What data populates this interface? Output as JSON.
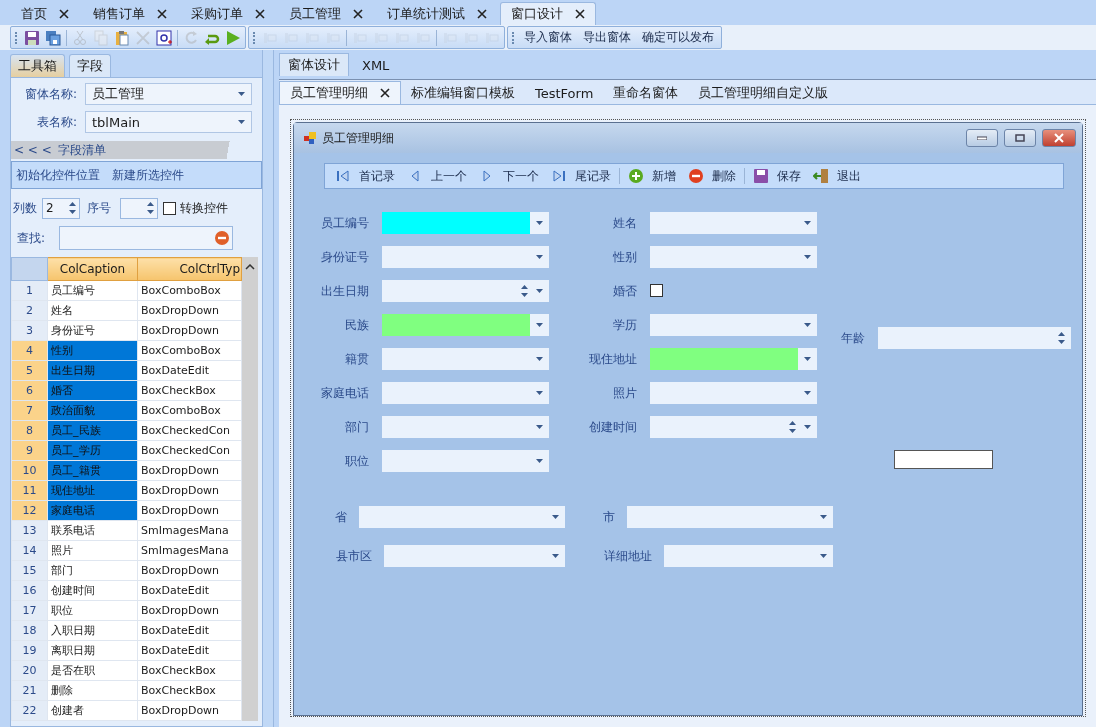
{
  "doc_tabs": [
    {
      "label": "首页",
      "selected": false
    },
    {
      "label": "销售订单",
      "selected": false
    },
    {
      "label": "采购订单",
      "selected": false
    },
    {
      "label": "员工管理",
      "selected": false
    },
    {
      "label": "订单统计测试",
      "selected": false
    },
    {
      "label": "窗口设计",
      "selected": true
    }
  ],
  "toolbar_icon_groups": [
    {
      "buttons": [
        {
          "disabled": false
        },
        {
          "disabled": false
        },
        {
          "disabled": true
        },
        {
          "disabled": true
        },
        {
          "disabled": false
        },
        {
          "disabled": true
        },
        {
          "disabled": false
        },
        {
          "disabled": true
        },
        {
          "disabled": false
        },
        {
          "disabled": false
        }
      ]
    },
    {
      "buttons": [
        {
          "disabled": true
        },
        {
          "disabled": true
        },
        {
          "disabled": true
        },
        {
          "disabled": true
        },
        {
          "disabled": true
        },
        {
          "disabled": true
        },
        {
          "disabled": true
        },
        {
          "disabled": true
        },
        {
          "disabled": true
        },
        {
          "disabled": true
        },
        {
          "disabled": true
        }
      ]
    }
  ],
  "toolbar_text_buttons": [
    "导入窗体",
    "导出窗体",
    "确定可以发布"
  ],
  "left_panel": {
    "tabs": [
      {
        "label": "工具箱",
        "selected": false
      },
      {
        "label": "字段",
        "selected": true
      }
    ],
    "form_name": {
      "label": "窗体名称:",
      "value": "员工管理"
    },
    "table_name": {
      "label": "表名称:",
      "value": "tblMain"
    },
    "section": {
      "collapse": "< < <",
      "title": "字段清单"
    },
    "actions": [
      "初始化控件位置",
      "新建所选控件"
    ],
    "columns_count": {
      "label": "列数",
      "value": "2"
    },
    "order": {
      "label": "序号"
    },
    "convert": {
      "label": "转换控件",
      "checked": false
    },
    "search": {
      "label": "查找:"
    },
    "grid": {
      "columns": [
        "ColCaption",
        "ColCtrlTyp"
      ],
      "rows": [
        {
          "num": "1",
          "caption": "员工编号",
          "type": "BoxComboBox",
          "selected": false
        },
        {
          "num": "2",
          "caption": "姓名",
          "type": "BoxDropDown",
          "selected": false
        },
        {
          "num": "3",
          "caption": "身份证号",
          "type": "BoxDropDown",
          "selected": false
        },
        {
          "num": "4",
          "caption": "性别",
          "type": "BoxComboBox",
          "selected": true
        },
        {
          "num": "5",
          "caption": "出生日期",
          "type": "BoxDateEdit",
          "selected": true
        },
        {
          "num": "6",
          "caption": "婚否",
          "type": "BoxCheckBox",
          "selected": true
        },
        {
          "num": "7",
          "caption": "政治面貌",
          "type": "BoxComboBox",
          "selected": true
        },
        {
          "num": "8",
          "caption": "员工_民族",
          "type": "BoxCheckedCon",
          "selected": true
        },
        {
          "num": "9",
          "caption": "员工_学历",
          "type": "BoxCheckedCon",
          "selected": true
        },
        {
          "num": "10",
          "caption": "员工_籍贯",
          "type": "BoxDropDown",
          "selected": true
        },
        {
          "num": "11",
          "caption": "现住地址",
          "type": "BoxDropDown",
          "selected": true
        },
        {
          "num": "12",
          "caption": "家庭电话",
          "type": "BoxDropDown",
          "selected": true
        },
        {
          "num": "13",
          "caption": "联系电话",
          "type": "SmImagesMana",
          "selected": false
        },
        {
          "num": "14",
          "caption": "照片",
          "type": "SmImagesMana",
          "selected": false
        },
        {
          "num": "15",
          "caption": "部门",
          "type": "BoxDropDown",
          "selected": false
        },
        {
          "num": "16",
          "caption": "创建时间",
          "type": "BoxDateEdit",
          "selected": false
        },
        {
          "num": "17",
          "caption": "职位",
          "type": "BoxDropDown",
          "selected": false
        },
        {
          "num": "18",
          "caption": "入职日期",
          "type": "BoxDateEdit",
          "selected": false
        },
        {
          "num": "19",
          "caption": "离职日期",
          "type": "BoxDateEdit",
          "selected": false
        },
        {
          "num": "20",
          "caption": "是否在职",
          "type": "BoxCheckBox",
          "selected": false
        },
        {
          "num": "21",
          "caption": "删除",
          "type": "BoxCheckBox",
          "selected": false
        },
        {
          "num": "22",
          "caption": "创建者",
          "type": "BoxDropDown",
          "selected": false
        }
      ]
    }
  },
  "view_tabs": [
    {
      "label": "窗体设计",
      "selected": true
    },
    {
      "label": "XML",
      "selected": false
    }
  ],
  "form_tabs": [
    {
      "label": "员工管理明细",
      "selected": true
    },
    {
      "label": "标准编辑窗口模板",
      "selected": false
    },
    {
      "label": "TestForm",
      "selected": false
    },
    {
      "label": "重命名窗体",
      "selected": false
    },
    {
      "label": "员工管理明细自定义版",
      "selected": false
    }
  ],
  "designed_form": {
    "title": "员工管理明细",
    "nav_buttons": [
      {
        "label": "首记录"
      },
      {
        "label": "上一个"
      },
      {
        "label": "下一个"
      },
      {
        "label": "尾记录"
      },
      {
        "label": "新增"
      },
      {
        "label": "删除"
      },
      {
        "label": "保存"
      },
      {
        "label": "退出"
      }
    ],
    "fields": [
      {
        "label": "员工编号",
        "kind": "combo",
        "color": "#00ffff"
      },
      {
        "label": "身份证号",
        "kind": "combo"
      },
      {
        "label": "出生日期",
        "kind": "date"
      },
      {
        "label": "民族",
        "kind": "combo",
        "color": "#80ff80"
      },
      {
        "label": "籍贯",
        "kind": "combo"
      },
      {
        "label": "家庭电话",
        "kind": "combo"
      },
      {
        "label": "部门",
        "kind": "combo"
      },
      {
        "label": "职位",
        "kind": "combo"
      },
      {
        "label": "姓名",
        "kind": "combo"
      },
      {
        "label": "性别",
        "kind": "combo"
      },
      {
        "label": "婚否",
        "kind": "check",
        "checked": false
      },
      {
        "label": "学历",
        "kind": "combo"
      },
      {
        "label": "现住地址",
        "kind": "combo",
        "color": "#80ff80"
      },
      {
        "label": "照片",
        "kind": "combo"
      },
      {
        "label": "创建时间",
        "kind": "date"
      },
      {
        "label": "年龄",
        "kind": "spin"
      },
      {
        "kind": "textbox"
      },
      {
        "label": "省",
        "kind": "combo"
      },
      {
        "label": "市",
        "kind": "combo"
      },
      {
        "label": "县市区",
        "kind": "combo"
      },
      {
        "label": "详细地址",
        "kind": "combo"
      }
    ]
  }
}
